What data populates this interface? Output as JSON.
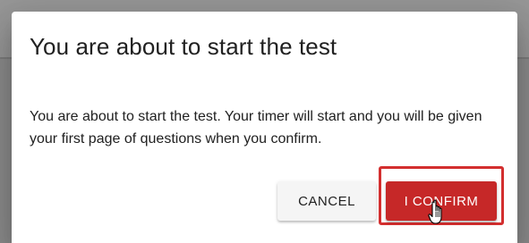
{
  "dialog": {
    "title": "You are about to start the test",
    "body": "You are about to start the test. Your timer will start and you will be given your first page of questions when you confirm.",
    "cancel_label": "CANCEL",
    "confirm_label": "I CONFIRM"
  },
  "colors": {
    "confirm_button": "#c62828",
    "highlight_border": "#d32f2f",
    "cancel_button": "#f5f5f5"
  },
  "icons": {
    "cursor": "hand-pointer-icon"
  }
}
